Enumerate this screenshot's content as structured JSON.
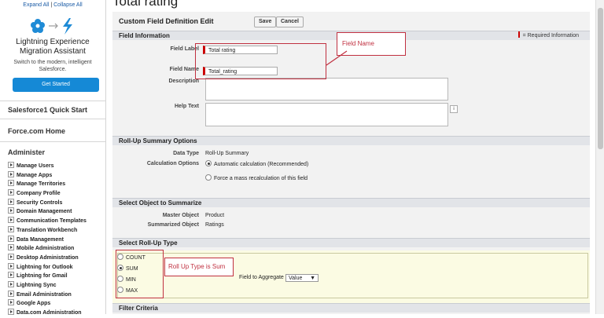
{
  "sidebar": {
    "expand_all": "Expand All",
    "separator": "|",
    "collapse_all": "Collapse All",
    "promo_title_1": "Lightning Experience",
    "promo_title_2": "Migration Assistant",
    "promo_sub": "Switch to the modern, intelligent Salesforce.",
    "promo_button": "Get Started",
    "quick_start": "Salesforce1 Quick Start",
    "force_home": "Force.com Home",
    "administer": "Administer",
    "items": [
      "Manage Users",
      "Manage Apps",
      "Manage Territories",
      "Company Profile",
      "Security Controls",
      "Domain Management",
      "Communication Templates",
      "Translation Workbench",
      "Data Management",
      "Mobile Administration",
      "Desktop Administration",
      "Lightning for Outlook",
      "Lightning for Gmail",
      "Lightning Sync",
      "Email Administration",
      "Google Apps",
      "Data.com Administration"
    ],
    "accent_color": "#1589d6"
  },
  "page": {
    "title": "Total rating",
    "edit_title": "Custom Field Definition Edit",
    "save_label": "Save",
    "cancel_label": "Cancel"
  },
  "field_info": {
    "section_title": "Field Information",
    "required_info": "= Required Information",
    "field_label_label": "Field Label",
    "field_label_value": "Total rating",
    "field_name_label": "Field Name",
    "field_name_value": "Total_rating",
    "description_label": "Description",
    "help_text_label": "Help Text",
    "info_icon": "i"
  },
  "rollup_options": {
    "section_title": "Roll-Up Summary Options",
    "data_type_label": "Data Type",
    "data_type_value": "Roll-Up Summary",
    "calc_label": "Calculation Options",
    "calc_opt1": "Automatic calculation (Recommended)",
    "calc_opt2": "Force a mass recalculation of this field"
  },
  "summarize": {
    "section_title": "Select Object to Summarize",
    "master_label": "Master Object",
    "master_value": "Product",
    "summarized_label": "Summarized Object",
    "summarized_value": "Ratings"
  },
  "rollup_type": {
    "section_title": "Select Roll-Up Type",
    "options": [
      "COUNT",
      "SUM",
      "MIN",
      "MAX"
    ],
    "selected": "SUM",
    "aggregate_label": "Field to Aggregate",
    "aggregate_value": "Value"
  },
  "filter": {
    "section_title": "Filter Criteria"
  },
  "annotations": {
    "field_name_callout": "Field Name",
    "rollup_callout": "Roll Up Type is Sum",
    "color": "#c03040"
  }
}
